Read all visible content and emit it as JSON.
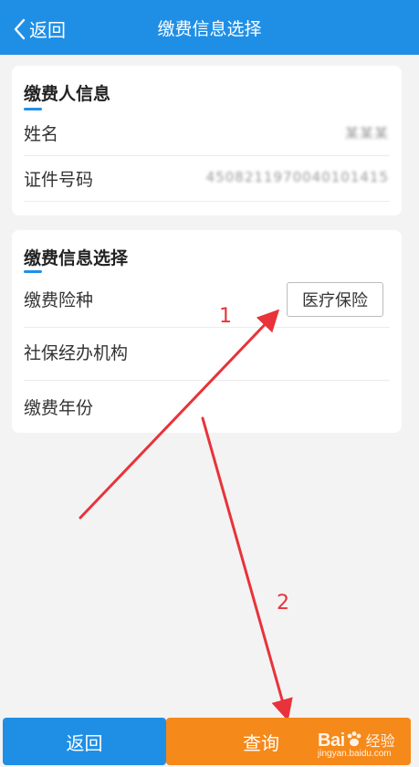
{
  "header": {
    "back_label": "返回",
    "title": "缴费信息选择"
  },
  "payer": {
    "section_title": "缴费人信息",
    "name_label": "姓名",
    "name_value": "某某某",
    "id_label": "证件号码",
    "id_value": "4508211970040101415"
  },
  "payment": {
    "section_title": "缴费信息选择",
    "insurance_label": "缴费险种",
    "insurance_value": "医疗保险",
    "agency_label": "社保经办机构",
    "year_label": "缴费年份"
  },
  "annotations": {
    "step1": "1",
    "step2": "2",
    "color": "#e8333a"
  },
  "footer": {
    "back_label": "返回",
    "query_label": "查询"
  },
  "watermark": {
    "main": "Bai",
    "cn": "经验",
    "url": "jingyan.baidu.com"
  },
  "colors": {
    "primary": "#1f8fe6",
    "accent": "#f5891a"
  }
}
